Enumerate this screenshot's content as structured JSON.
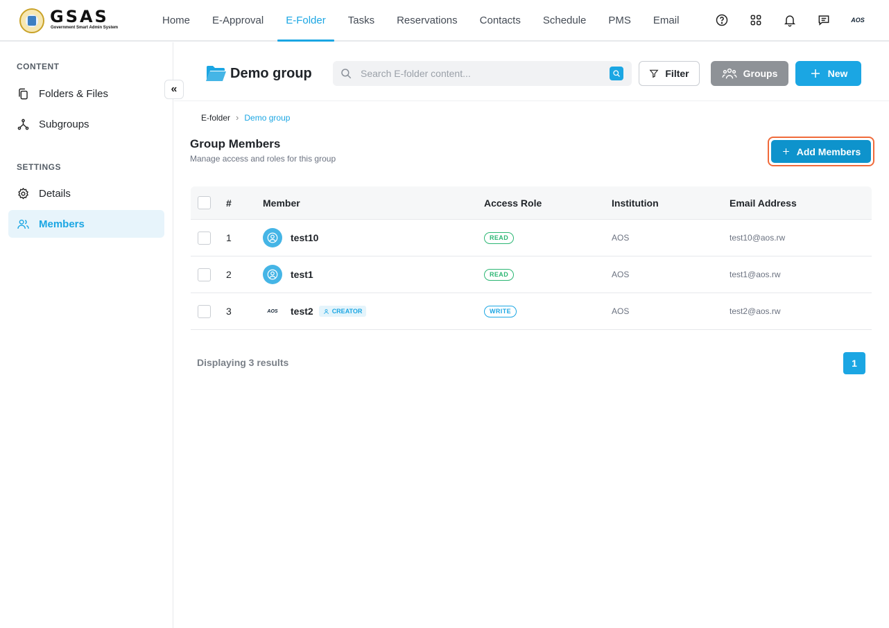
{
  "app": {
    "brand": "GSAS",
    "brand_subtitle": "Government Smart Admin System"
  },
  "nav": {
    "items": [
      {
        "label": "Home"
      },
      {
        "label": "E-Approval"
      },
      {
        "label": "E-Folder",
        "active": true
      },
      {
        "label": "Tasks"
      },
      {
        "label": "Reservations"
      },
      {
        "label": "Contacts"
      },
      {
        "label": "Schedule"
      },
      {
        "label": "PMS"
      },
      {
        "label": "Email"
      }
    ],
    "icons": [
      "help-icon",
      "apps-grid-icon",
      "bell-icon",
      "chat-icon"
    ],
    "org_avatar": "AOS"
  },
  "sidebar": {
    "content_label": "CONTENT",
    "settings_label": "SETTINGS",
    "items": [
      {
        "label": "Folders & Files",
        "icon": "files-icon"
      },
      {
        "label": "Subgroups",
        "icon": "subgroups-icon"
      },
      {
        "label": "Details",
        "icon": "gear-icon"
      },
      {
        "label": "Members",
        "icon": "users-icon",
        "active": true
      }
    ]
  },
  "header": {
    "folder_title": "Demo group",
    "search_placeholder": "Search E-folder content...",
    "filter_label": "Filter",
    "groups_label": "Groups",
    "new_label": "New"
  },
  "breadcrumb": {
    "root": "E-folder",
    "current": "Demo group"
  },
  "page": {
    "title": "Group Members",
    "subtitle": "Manage access and roles for this group",
    "add_members_label": "Add Members"
  },
  "table": {
    "columns": [
      "#",
      "Member",
      "Access Role",
      "Institution",
      "Email Address"
    ],
    "rows": [
      {
        "num": "1",
        "member": "test10",
        "role": "READ",
        "institution": "AOS",
        "email": "test10@aos.rw"
      },
      {
        "num": "2",
        "member": "test1",
        "role": "READ",
        "institution": "AOS",
        "email": "test1@aos.rw"
      },
      {
        "num": "3",
        "member": "test2",
        "badge": "CREATOR",
        "avatar_text": "AOS",
        "role": "WRITE",
        "institution": "AOS",
        "email": "test2@aos.rw"
      }
    ]
  },
  "footer": {
    "results_text": "Displaying 3 results",
    "current_page": "1"
  },
  "colors": {
    "accent": "#1ba6e3",
    "add_button": "#0e93cc",
    "groups_button": "#8e9297",
    "read_badge": "#2bb673",
    "highlight_outline": "#f06a3a"
  }
}
